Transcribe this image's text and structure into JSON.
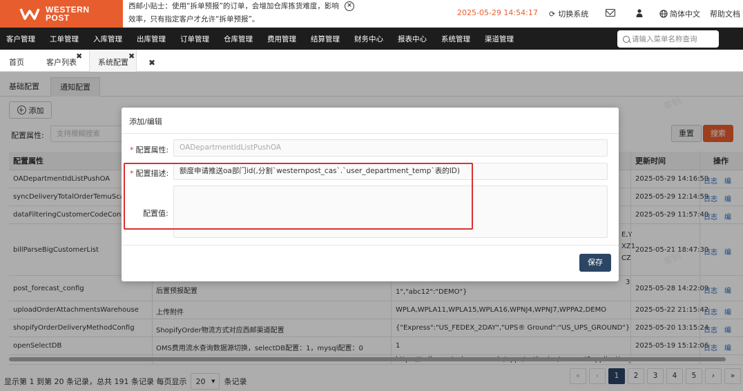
{
  "header": {
    "logo_line1": "WESTERN",
    "logo_line2": "POST",
    "tip_text": "西邮小贴士：使用“拆单预报”的订单，会增加仓库拣货难度，影响效率，只有指定客户才允许“拆单预报”。",
    "datetime": "2025-05-29 14:54:17",
    "switch_system": "切换系统",
    "language": "简体中文",
    "help": "帮助文档"
  },
  "nav": {
    "items": [
      "客户管理",
      "工单管理",
      "入库管理",
      "出库管理",
      "订单管理",
      "仓库管理",
      "费用管理",
      "结算管理",
      "财务中心",
      "报表中心",
      "系统管理",
      "渠道管理"
    ],
    "search_placeholder": "请输入菜单名称查询"
  },
  "tabs": {
    "home": "首页",
    "customers": "客户列表",
    "system_config": "系统配置"
  },
  "subtabs": {
    "basic": "基础配置",
    "notify": "通知配置"
  },
  "toolbar": {
    "add_label": "添加",
    "filter_label": "配置属性:",
    "filter_placeholder": "支持模糊搜索",
    "reset_label": "重置",
    "search_label": "搜索"
  },
  "table": {
    "headers": {
      "attr": "配置属性",
      "time": "更新时间",
      "op": "操作"
    },
    "rows": [
      {
        "attr": "OADepartmentIdListPushOA",
        "desc": "",
        "val": "",
        "time": "2025-05-29 14:16:50",
        "op": "日志"
      },
      {
        "attr": "syncDeliveryTotalOrderTemuScanFor",
        "desc": "",
        "val": "",
        "time": "2025-05-29 12:14:59",
        "op": "日志"
      },
      {
        "attr": "dataFilteringCustomerCodeConfigur",
        "desc": "",
        "val": "",
        "time": "2025-05-29 11:57:40",
        "op": "日志"
      },
      {
        "attr": "billParseBigCustomerList",
        "desc": "",
        "val": "",
        "val_right": [
          "E,Y",
          "XZ1",
          "CZ"
        ],
        "time": "2025-05-21 18:47:30",
        "op": "日志"
      },
      {
        "attr": "post_forecast_config",
        "desc": "后置预报配置",
        "val": "1\",\"abc12\":\"DEMO\"}",
        "val_tail": "3",
        "time": "2025-05-28 14:22:09",
        "op": "日志"
      },
      {
        "attr": "uploadOrderAttachmentsWarehouse",
        "desc": "上传附件",
        "val": "WPLA,WPLA11,WPLA15,WPLA16,WPNJ4,WPNJ7,WPPA2,DEMO",
        "time": "2025-05-22 21:15:42",
        "op": "日志"
      },
      {
        "attr": "shopifyOrderDeliveryMethodConfig",
        "desc": "ShopifyOrder物流方式对应西邮渠道配置",
        "val": "{\"Express\":\"US_FEDEX_2DAY\",\"UPS® Ground\":\"US_UPS_GROUND\"}",
        "time": "2025-05-20 13:15:24",
        "op": "日志"
      },
      {
        "attr": "openSelectDB",
        "desc": "OMS费用流水查询数据源切换，selectDB配置：1，mysql配置：0",
        "val": "1",
        "time": "2025-05-19 15:12:06",
        "op": "日志"
      },
      {
        "attr": "",
        "desc": "",
        "val": "https://sellercentral.amazon.de/apps/authorize/consent?application_id=amzn",
        "time": "",
        "op": ""
      }
    ]
  },
  "pagination": {
    "info_prefix": "显示第 1 到第 20 条记录，总共 191 条记录 每页显示",
    "page_size": "20",
    "info_suffix": "条记录",
    "first": "«",
    "prev": "‹",
    "pages": [
      "1",
      "2",
      "3",
      "4",
      "5"
    ],
    "next": "›",
    "last": "»"
  },
  "modal": {
    "title": "添加/编辑",
    "attr_label": "配置属性:",
    "attr_value": "OADepartmentIdListPushOA",
    "desc_label": "配置描述:",
    "desc_value": "额度申请推送oa部门id(,分割`westernpost_cas`.`user_department_temp`表的ID)",
    "val_label": "配置值:",
    "val_value": "",
    "save_label": "保存"
  },
  "watermark": "零钊",
  "colors": {
    "brand": "#e85d2d",
    "nav_bg": "#1d1d1d",
    "primary_btn": "#2c4565",
    "highlight": "#d93030",
    "link": "#2a6ebb"
  }
}
